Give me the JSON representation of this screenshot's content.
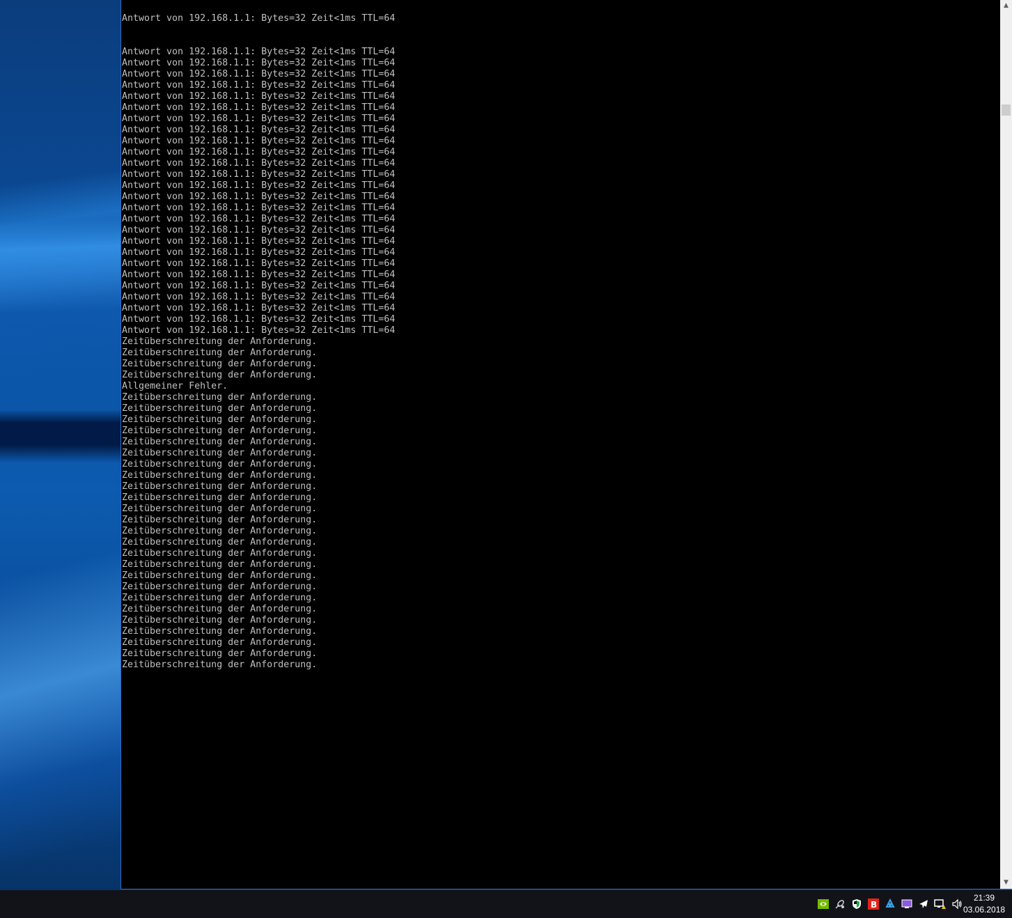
{
  "console": {
    "partial_top_line": "Antwort von 192.168.1.1: Bytes=32 Zeit<1ms TTL=64",
    "lines": [
      "Antwort von 192.168.1.1: Bytes=32 Zeit<1ms TTL=64",
      "Antwort von 192.168.1.1: Bytes=32 Zeit<1ms TTL=64",
      "Antwort von 192.168.1.1: Bytes=32 Zeit<1ms TTL=64",
      "Antwort von 192.168.1.1: Bytes=32 Zeit<1ms TTL=64",
      "Antwort von 192.168.1.1: Bytes=32 Zeit<1ms TTL=64",
      "Antwort von 192.168.1.1: Bytes=32 Zeit<1ms TTL=64",
      "Antwort von 192.168.1.1: Bytes=32 Zeit<1ms TTL=64",
      "Antwort von 192.168.1.1: Bytes=32 Zeit<1ms TTL=64",
      "Antwort von 192.168.1.1: Bytes=32 Zeit<1ms TTL=64",
      "Antwort von 192.168.1.1: Bytes=32 Zeit<1ms TTL=64",
      "Antwort von 192.168.1.1: Bytes=32 Zeit<1ms TTL=64",
      "Antwort von 192.168.1.1: Bytes=32 Zeit<1ms TTL=64",
      "Antwort von 192.168.1.1: Bytes=32 Zeit<1ms TTL=64",
      "Antwort von 192.168.1.1: Bytes=32 Zeit<1ms TTL=64",
      "Antwort von 192.168.1.1: Bytes=32 Zeit<1ms TTL=64",
      "Antwort von 192.168.1.1: Bytes=32 Zeit<1ms TTL=64",
      "Antwort von 192.168.1.1: Bytes=32 Zeit<1ms TTL=64",
      "Antwort von 192.168.1.1: Bytes=32 Zeit<1ms TTL=64",
      "Antwort von 192.168.1.1: Bytes=32 Zeit<1ms TTL=64",
      "Antwort von 192.168.1.1: Bytes=32 Zeit<1ms TTL=64",
      "Antwort von 192.168.1.1: Bytes=32 Zeit<1ms TTL=64",
      "Antwort von 192.168.1.1: Bytes=32 Zeit<1ms TTL=64",
      "Antwort von 192.168.1.1: Bytes=32 Zeit<1ms TTL=64",
      "Antwort von 192.168.1.1: Bytes=32 Zeit<1ms TTL=64",
      "Antwort von 192.168.1.1: Bytes=32 Zeit<1ms TTL=64",
      "Antwort von 192.168.1.1: Bytes=32 Zeit<1ms TTL=64",
      "Zeitüberschreitung der Anforderung.",
      "Zeitüberschreitung der Anforderung.",
      "Zeitüberschreitung der Anforderung.",
      "Zeitüberschreitung der Anforderung.",
      "Allgemeiner Fehler.",
      "Zeitüberschreitung der Anforderung.",
      "Zeitüberschreitung der Anforderung.",
      "Zeitüberschreitung der Anforderung.",
      "Zeitüberschreitung der Anforderung.",
      "Zeitüberschreitung der Anforderung.",
      "Zeitüberschreitung der Anforderung.",
      "Zeitüberschreitung der Anforderung.",
      "Zeitüberschreitung der Anforderung.",
      "Zeitüberschreitung der Anforderung.",
      "Zeitüberschreitung der Anforderung.",
      "Zeitüberschreitung der Anforderung.",
      "Zeitüberschreitung der Anforderung.",
      "Zeitüberschreitung der Anforderung.",
      "Zeitüberschreitung der Anforderung.",
      "Zeitüberschreitung der Anforderung.",
      "Zeitüberschreitung der Anforderung.",
      "Zeitüberschreitung der Anforderung.",
      "Zeitüberschreitung der Anforderung.",
      "Zeitüberschreitung der Anforderung.",
      "Zeitüberschreitung der Anforderung.",
      "Zeitüberschreitung der Anforderung.",
      "Zeitüberschreitung der Anforderung.",
      "Zeitüberschreitung der Anforderung.",
      "Zeitüberschreitung der Anforderung.",
      "Zeitüberschreitung der Anforderung."
    ]
  },
  "scrollbar": {
    "up_arrow": "▲",
    "down_arrow": "▼"
  },
  "taskbar": {
    "tray_icons": [
      {
        "name": "nvidia-icon",
        "color": "#76b900"
      },
      {
        "name": "satellite-icon",
        "color": "#d0d0d0"
      },
      {
        "name": "security-shield-icon",
        "color": "#1fa84a"
      },
      {
        "name": "bitdefender-icon",
        "color": "#e2231a"
      },
      {
        "name": "network-cloud-icon",
        "color": "#3aa0e8"
      },
      {
        "name": "display-icon",
        "color": "#8a5cd8"
      },
      {
        "name": "airplane-icon",
        "color": "#ffffff"
      },
      {
        "name": "network-warning-icon",
        "color": "#ffffff"
      },
      {
        "name": "speaker-icon",
        "color": "#ffffff"
      }
    ],
    "clock": {
      "time": "21:39",
      "date": "03.06.2018"
    }
  }
}
